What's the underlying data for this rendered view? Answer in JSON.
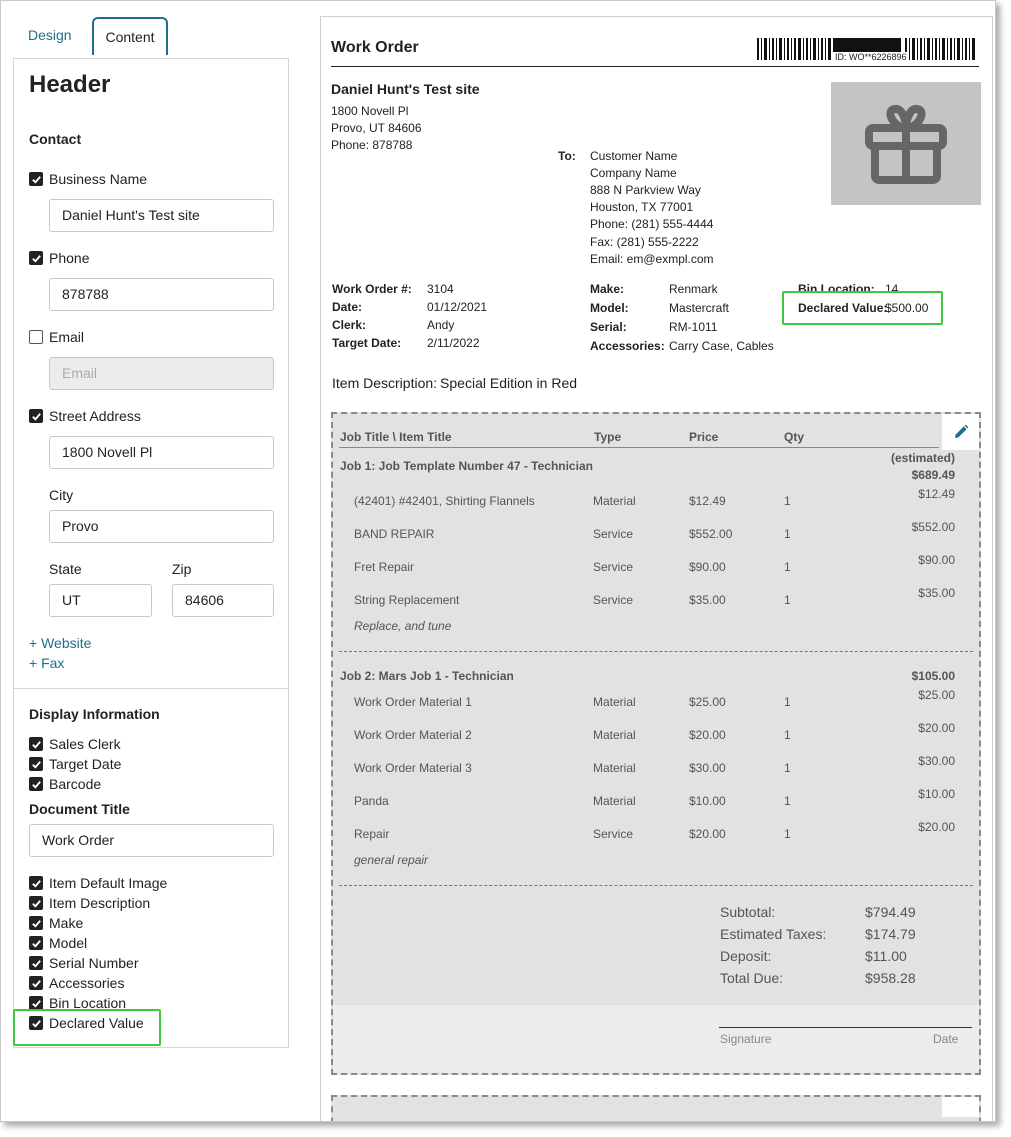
{
  "tabs": {
    "design": "Design",
    "content": "Content"
  },
  "left": {
    "heading": "Header",
    "contact_title": "Contact",
    "business_name": {
      "label": "Business Name",
      "checked": true,
      "value": "Daniel Hunt's Test site"
    },
    "phone": {
      "label": "Phone",
      "checked": true,
      "value": "878788"
    },
    "email": {
      "label": "Email",
      "checked": false,
      "placeholder": "Email"
    },
    "street": {
      "label": "Street Address",
      "checked": true,
      "value": "1800 Novell Pl"
    },
    "city": {
      "label": "City",
      "value": "Provo"
    },
    "state": {
      "label": "State",
      "value": "UT"
    },
    "zip": {
      "label": "Zip",
      "value": "84606"
    },
    "add_website": "+ Website",
    "add_fax": "+ Fax",
    "display_title": "Display Information",
    "display_items": [
      "Sales Clerk",
      "Target Date",
      "Barcode"
    ],
    "doc_title_label": "Document Title",
    "doc_title_value": "Work Order",
    "display_items2": [
      "Item Default Image",
      "Item Description",
      "Make",
      "Model",
      "Serial Number",
      "Accessories",
      "Bin Location",
      "Declared Value"
    ]
  },
  "doc": {
    "title": "Work Order",
    "barcode_id": "ID: WO**6226896",
    "business_name": "Daniel Hunt's Test site",
    "address1": "1800 Novell Pl",
    "address2": "Provo, UT 84606",
    "phone": "Phone: 878788",
    "to_label": "To:",
    "to_lines": [
      "Customer Name",
      "Company Name",
      "888 N Parkview Way",
      "Houston, TX 77001",
      "Phone: (281) 555-4444",
      "Fax: (281) 555-2222",
      "Email: em@exmpl.com"
    ],
    "info_col1": [
      {
        "label": "Work Order #:",
        "value": "3104"
      },
      {
        "label": "Date:",
        "value": "01/12/2021"
      },
      {
        "label": "Clerk:",
        "value": "Andy"
      },
      {
        "label": "Target Date:",
        "value": "2/11/2022"
      }
    ],
    "info_col2": [
      {
        "label": "Make:",
        "value": "Renmark"
      },
      {
        "label": "Model:",
        "value": "Mastercraft"
      },
      {
        "label": "Serial:",
        "value": "RM-1011"
      },
      {
        "label": "Accessories:",
        "value": "Carry Case, Cables"
      }
    ],
    "bin_label": "Bin Location:",
    "bin_value": "14",
    "declared_label": "Declared Value:",
    "declared_value": "$500.00",
    "item_desc_label": "Item Description:",
    "item_desc_value": "Special Edition in Red",
    "headers": [
      "Job Title \\ Item Title",
      "Type",
      "Price",
      "Qty"
    ],
    "job1": {
      "name": "Job 1: Job Template Number 47 - Technician",
      "estimated": "(estimated)",
      "total": "$689.49",
      "items": [
        {
          "title": "(42401) #42401, Shirting Flannels",
          "type": "Material",
          "price": "$12.49",
          "qty": "1",
          "amount": "$12.49"
        },
        {
          "title": "BAND REPAIR",
          "type": "Service",
          "price": "$552.00",
          "qty": "1",
          "amount": "$552.00"
        },
        {
          "title": "Fret Repair",
          "type": "Service",
          "price": "$90.00",
          "qty": "1",
          "amount": "$90.00"
        },
        {
          "title": "String Replacement",
          "type": "Service",
          "price": "$35.00",
          "qty": "1",
          "amount": "$35.00"
        }
      ],
      "note": "Replace, and tune"
    },
    "job2": {
      "name": "Job 2: Mars Job 1 - Technician",
      "total": "$105.00",
      "items": [
        {
          "title": "Work Order Material 1",
          "type": "Material",
          "price": "$25.00",
          "qty": "1",
          "amount": "$25.00"
        },
        {
          "title": "Work Order Material 2",
          "type": "Material",
          "price": "$20.00",
          "qty": "1",
          "amount": "$20.00"
        },
        {
          "title": "Work Order Material 3",
          "type": "Material",
          "price": "$30.00",
          "qty": "1",
          "amount": "$30.00"
        },
        {
          "title": "Panda",
          "type": "Material",
          "price": "$10.00",
          "qty": "1",
          "amount": "$10.00"
        },
        {
          "title": "Repair",
          "type": "Service",
          "price": "$20.00",
          "qty": "1",
          "amount": "$20.00"
        }
      ],
      "note": "general repair"
    },
    "summary": [
      {
        "label": "Subtotal:",
        "value": "$794.49"
      },
      {
        "label": "Estimated Taxes:",
        "value": "$174.79"
      },
      {
        "label": "Deposit:",
        "value": "$11.00"
      },
      {
        "label": "Total Due:",
        "value": "$958.28"
      }
    ],
    "signature_label": "Signature",
    "date_label": "Date"
  },
  "colors": {
    "link": "#1f6e8c",
    "highlight": "#3ec93e",
    "jobs_bg": "#e2e2e2",
    "image_bg": "#c4c4c4"
  },
  "icons": {
    "checkbox": "check-icon",
    "image": "gift-icon",
    "edit": "pencil-icon"
  }
}
